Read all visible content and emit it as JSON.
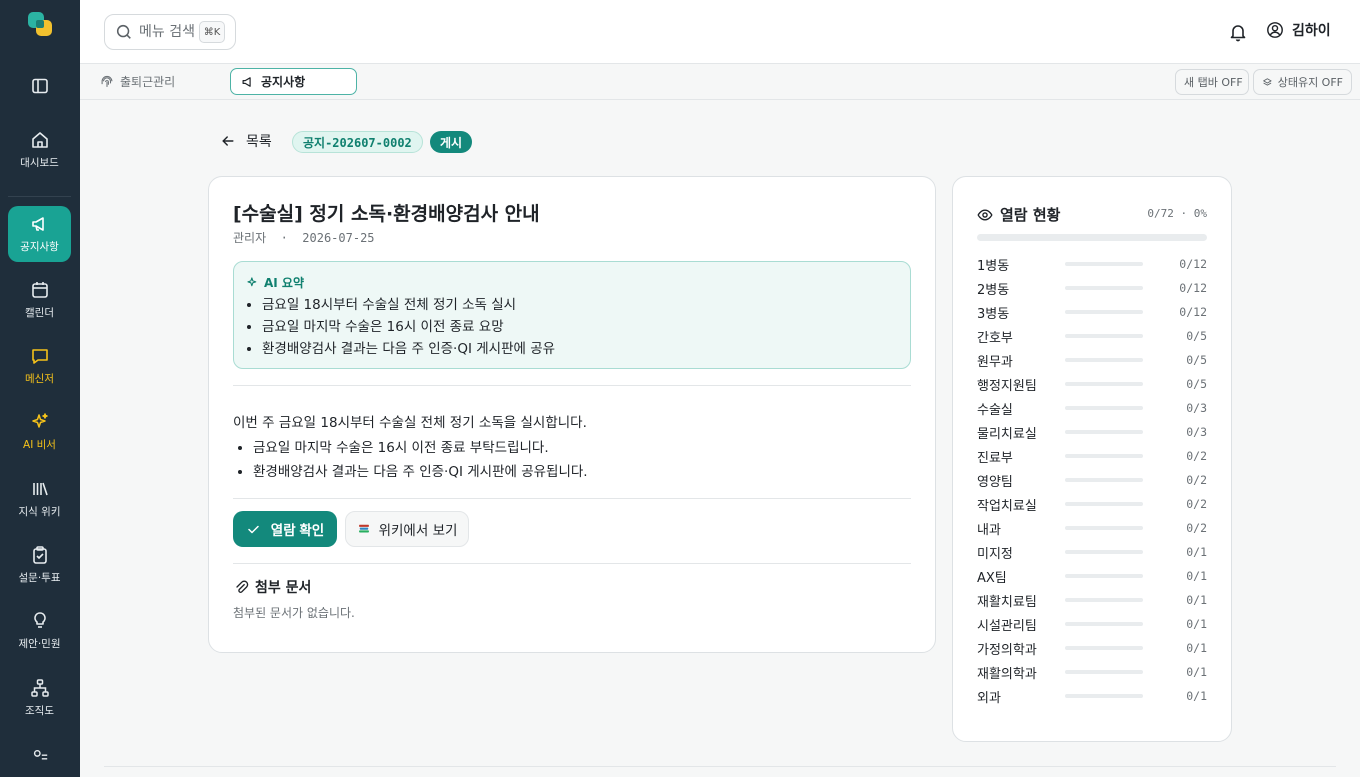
{
  "sidebar": {
    "items": [
      {
        "label": "대시보드",
        "icon": "home-icon"
      },
      {
        "label": "공지사항",
        "icon": "megaphone-icon",
        "active": true
      },
      {
        "label": "캘린더",
        "icon": "calendar-icon"
      },
      {
        "label": "메신저",
        "icon": "chat-icon",
        "highlight": true
      },
      {
        "label": "AI 비서",
        "icon": "sparkle-icon",
        "highlight": true
      },
      {
        "label": "지식 위키",
        "icon": "library-icon"
      },
      {
        "label": "설문·투표",
        "icon": "clipboard-icon"
      },
      {
        "label": "제안·민원",
        "icon": "lightbulb-icon"
      },
      {
        "label": "조직도",
        "icon": "org-chart-icon"
      }
    ]
  },
  "header": {
    "search_placeholder": "메뉴 검색",
    "search_shortcut": "⌘K",
    "user_name": "김하이"
  },
  "tabs": {
    "inactive_label": "출퇴근관리",
    "active_label": "공지사항",
    "new_tab_toggle": "새 탭바 OFF",
    "keep_state_toggle": "상태유지 OFF"
  },
  "notice": {
    "back_label": "목록",
    "code": "공지-202607-0002",
    "status": "게시",
    "title": "[수술실] 정기 소독·환경배양검사 안내",
    "author": "관리자",
    "separator": "·",
    "date": "2026-07-25",
    "ai_summary_label": "AI 요약",
    "ai_summary": [
      "금요일 18시부터 수술실 전체 정기 소독 실시",
      "금요일 마지막 수술은 16시 이전 종료 요망",
      "환경배양검사 결과는 다음 주 인증·QI 게시판에 공유"
    ],
    "body_intro": "이번 주 금요일 18시부터 수술실 전체 정기 소독을 실시합니다.",
    "body_items": [
      "금요일 마지막 수술은 16시 이전 종료 부탁드립니다.",
      "환경배양검사 결과는 다음 주 인증·QI 게시판에 공유됩니다."
    ],
    "confirm_button": "열람 확인",
    "wiki_button": "위키에서 보기",
    "attachments_label": "첨부 문서",
    "attachments_empty": "첨부된 문서가 없습니다."
  },
  "read_status": {
    "title": "열람 현황",
    "total": "0/72 · 0%",
    "total_fraction": 0,
    "departments": [
      {
        "name": "1병동",
        "count": "0/12",
        "fraction": 0
      },
      {
        "name": "2병동",
        "count": "0/12",
        "fraction": 0
      },
      {
        "name": "3병동",
        "count": "0/12",
        "fraction": 0
      },
      {
        "name": "간호부",
        "count": "0/5",
        "fraction": 0
      },
      {
        "name": "원무과",
        "count": "0/5",
        "fraction": 0
      },
      {
        "name": "행정지원팀",
        "count": "0/5",
        "fraction": 0
      },
      {
        "name": "수술실",
        "count": "0/3",
        "fraction": 0
      },
      {
        "name": "물리치료실",
        "count": "0/3",
        "fraction": 0
      },
      {
        "name": "진료부",
        "count": "0/2",
        "fraction": 0
      },
      {
        "name": "영양팀",
        "count": "0/2",
        "fraction": 0
      },
      {
        "name": "작업치료실",
        "count": "0/2",
        "fraction": 0
      },
      {
        "name": "내과",
        "count": "0/2",
        "fraction": 0
      },
      {
        "name": "미지정",
        "count": "0/1",
        "fraction": 0
      },
      {
        "name": "AX팀",
        "count": "0/1",
        "fraction": 0
      },
      {
        "name": "재활치료팀",
        "count": "0/1",
        "fraction": 0
      },
      {
        "name": "시설관리팀",
        "count": "0/1",
        "fraction": 0
      },
      {
        "name": "가정의학과",
        "count": "0/1",
        "fraction": 0
      },
      {
        "name": "재활의학과",
        "count": "0/1",
        "fraction": 0
      },
      {
        "name": "외과",
        "count": "0/1",
        "fraction": 0
      }
    ]
  },
  "colors": {
    "sidebar_bg": "#1f2e3b",
    "accent": "#13897c",
    "active_nav": "#19a394",
    "highlight_nav": "#f5c21a"
  }
}
